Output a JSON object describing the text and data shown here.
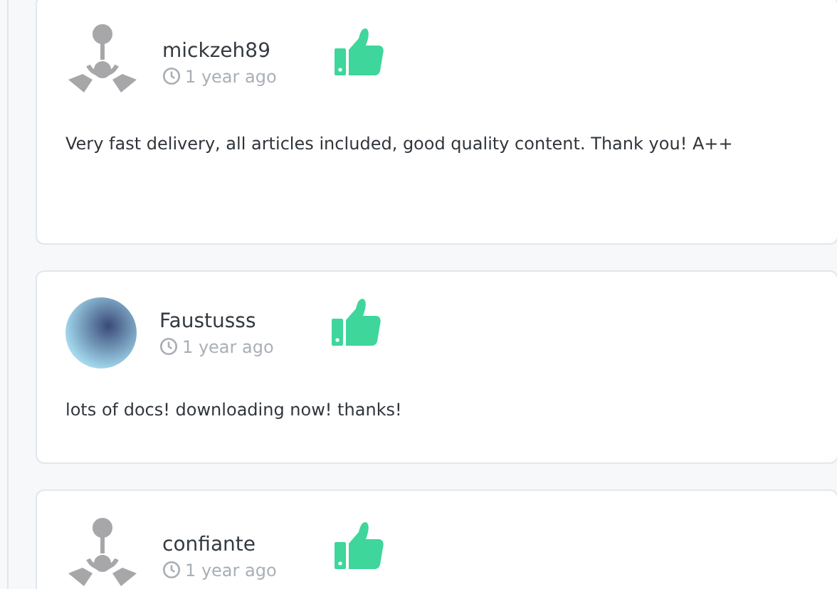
{
  "reviews": [
    {
      "author": "mickzeh89",
      "kind": "default",
      "time": "1 year ago",
      "comment": "Very fast delivery, all articles included, good quality content. Thank you! A++"
    },
    {
      "author": "Faustusss",
      "kind": "photo",
      "time": "1 year ago",
      "comment": "lots of docs! downloading now! thanks!"
    },
    {
      "author": "confiante",
      "kind": "default",
      "time": "1 year ago"
    }
  ]
}
